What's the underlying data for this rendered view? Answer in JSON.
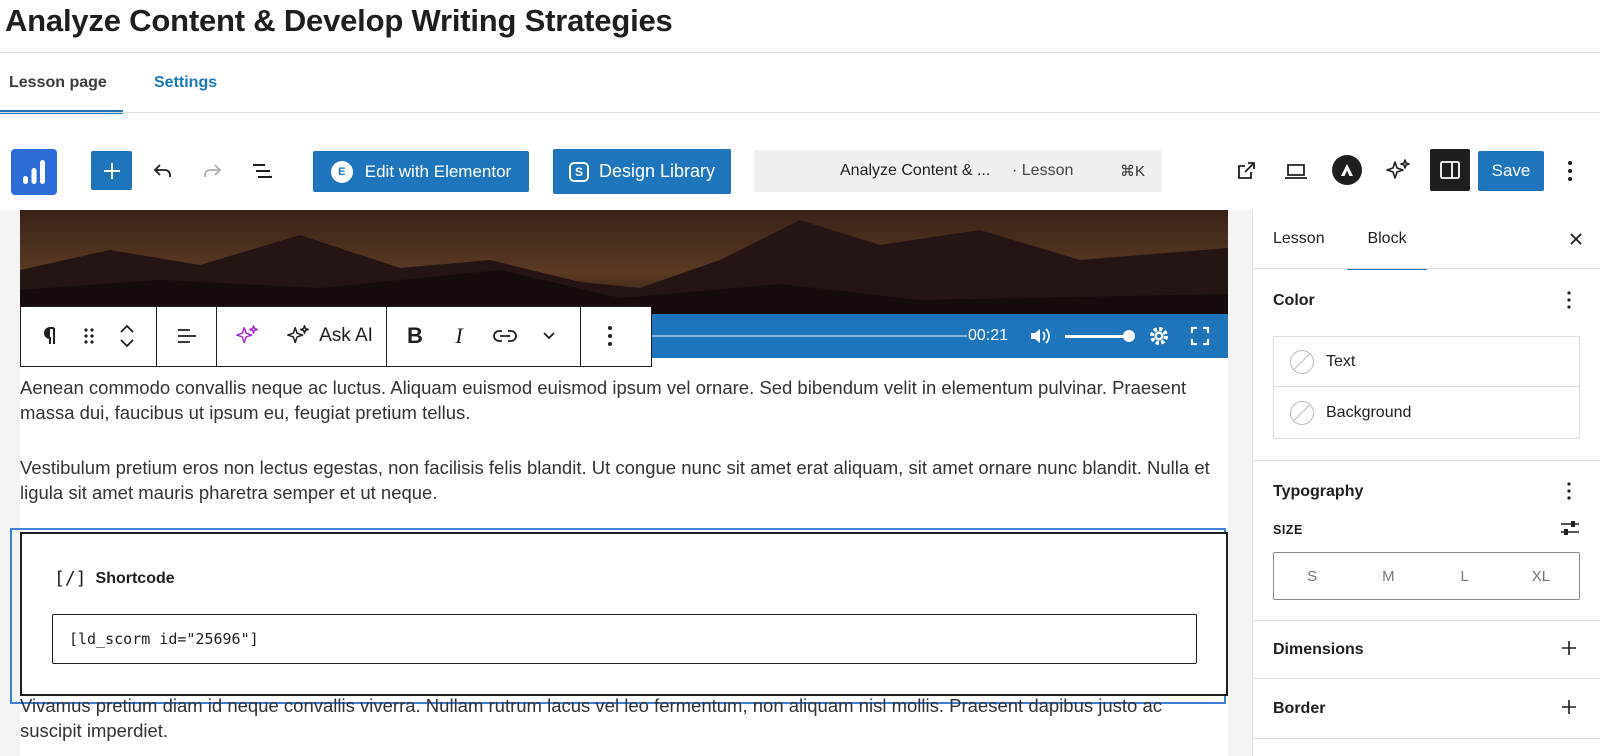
{
  "page": {
    "title": "Analyze Content & Develop Writing Strategies"
  },
  "tabs": {
    "lesson_page": "Lesson page",
    "settings": "Settings"
  },
  "toolbar": {
    "add_icon": "plus-icon",
    "edit_elementor": "Edit with Elementor",
    "design_library": "Design Library",
    "command_title": "Analyze Content & ...",
    "command_type": "· Lesson",
    "command_shortcut": "⌘K",
    "save": "Save"
  },
  "video": {
    "time": "00:21",
    "progress": 0.0
  },
  "block_toolbar": {
    "ask_ai": "Ask AI"
  },
  "content": {
    "p1": "Aenean commodo convallis neque ac luctus. Aliquam euismod euismod ipsum vel ornare. Sed bibendum velit in elementum pulvinar. Praesent massa dui, faucibus ut ipsum eu, feugiat pretium tellus.",
    "p2": "Vestibulum pretium eros non lectus egestas, non facilisis felis blandit. Ut congue nunc sit amet erat aliquam, sit amet ornare nunc blandit. Nulla et ligula sit amet mauris pharetra semper et ut neque.",
    "shortcode_title": "Shortcode",
    "shortcode_value": "[ld_scorm id=\"25696\"]",
    "p3": "Vivamus pretium diam id neque convallis viverra. Nullam rutrum lacus vel leo fermentum, non aliquam nisl mollis. Praesent dapibus justo ac suscipit imperdiet."
  },
  "sidebar": {
    "tab_lesson": "Lesson",
    "tab_block": "Block",
    "color_heading": "Color",
    "color_text": "Text",
    "color_background": "Background",
    "typography_heading": "Typography",
    "size_label": "SIZE",
    "sizes": [
      "S",
      "M",
      "L",
      "XL"
    ],
    "dimensions": "Dimensions",
    "border": "Border"
  },
  "colors": {
    "accent": "#1e75bb",
    "selection": "#3c80d8",
    "dark": "#1e1e1e"
  }
}
